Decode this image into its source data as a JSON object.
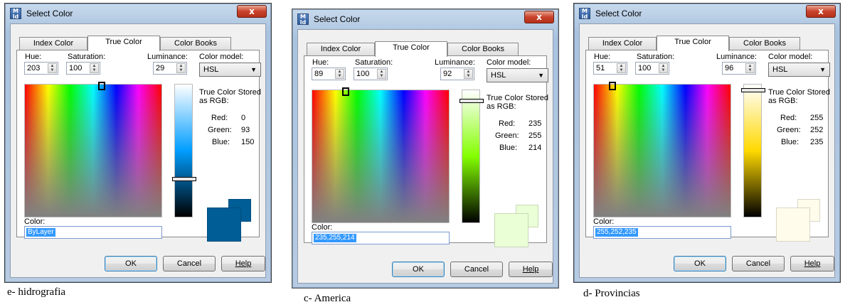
{
  "dialogs": [
    {
      "title": "Select Color",
      "close_glyph": "x",
      "tabs": [
        "Index Color",
        "True Color",
        "Color Books"
      ],
      "active_tab": "True Color",
      "labels": {
        "hue": "Hue:",
        "saturation": "Saturation:",
        "luminance": "Luminance:",
        "color_model": "Color model:"
      },
      "hue": "203",
      "saturation": "100",
      "luminance": "29",
      "color_model": "HSL",
      "stored_as": "True Color Stored as RGB:",
      "rgb_labels": {
        "red": "Red:",
        "green": "Green:",
        "blue": "Blue:"
      },
      "red": "0",
      "green": "93",
      "blue": "150",
      "color_label": "Color:",
      "color_value": "ByLayer",
      "swatch_color": "#005d96",
      "buttons": {
        "ok": "OK",
        "cancel": "Cancel",
        "help": "Help"
      },
      "caption": "e- hidrografia"
    },
    {
      "title": "Select Color",
      "close_glyph": "x",
      "tabs": [
        "Index Color",
        "True Color",
        "Color Books"
      ],
      "active_tab": "True Color",
      "labels": {
        "hue": "Hue:",
        "saturation": "Saturation:",
        "luminance": "Luminance:",
        "color_model": "Color model:"
      },
      "hue": "89",
      "saturation": "100",
      "luminance": "92",
      "color_model": "HSL",
      "stored_as": "True Color Stored as RGB:",
      "rgb_labels": {
        "red": "Red:",
        "green": "Green:",
        "blue": "Blue:"
      },
      "red": "235",
      "green": "255",
      "blue": "214",
      "color_label": "Color:",
      "color_value": "235,255,214",
      "swatch_color": "#ebffd6",
      "buttons": {
        "ok": "OK",
        "cancel": "Cancel",
        "help": "Help"
      },
      "caption": "c- America"
    },
    {
      "title": "Select Color",
      "close_glyph": "x",
      "tabs": [
        "Index Color",
        "True Color",
        "Color Books"
      ],
      "active_tab": "True Color",
      "labels": {
        "hue": "Hue:",
        "saturation": "Saturation:",
        "luminance": "Luminance:",
        "color_model": "Color model:"
      },
      "hue": "51",
      "saturation": "100",
      "luminance": "96",
      "color_model": "HSL",
      "stored_as": "True Color Stored as RGB:",
      "rgb_labels": {
        "red": "Red:",
        "green": "Green:",
        "blue": "Blue:"
      },
      "red": "255",
      "green": "252",
      "blue": "235",
      "color_label": "Color:",
      "color_value": "255,252,235",
      "swatch_color": "#fffceb",
      "buttons": {
        "ok": "OK",
        "cancel": "Cancel",
        "help": "Help"
      },
      "caption": "d- Provincias"
    }
  ]
}
